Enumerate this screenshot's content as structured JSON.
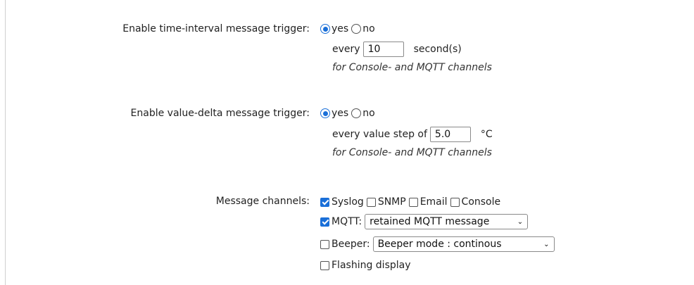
{
  "time_trigger": {
    "label": "Enable time-interval message trigger:",
    "yes": "yes",
    "no": "no",
    "selected": "yes",
    "every_label": "every",
    "value": "10",
    "unit": "second(s)",
    "note": "for Console- and MQTT channels"
  },
  "delta_trigger": {
    "label": "Enable value-delta message trigger:",
    "yes": "yes",
    "no": "no",
    "selected": "yes",
    "every_label": "every value step of",
    "value": "5.0",
    "unit": "°C",
    "note": "for Console- and MQTT channels"
  },
  "channels": {
    "label": "Message channels:",
    "syslog": {
      "label": "Syslog",
      "checked": true
    },
    "snmp": {
      "label": "SNMP",
      "checked": false
    },
    "email": {
      "label": "Email",
      "checked": false
    },
    "console": {
      "label": "Console",
      "checked": false
    },
    "mqtt": {
      "label": "MQTT:",
      "checked": true,
      "select_value": "retained MQTT message"
    },
    "beeper": {
      "label": "Beeper:",
      "checked": false,
      "select_value": "Beeper mode : continous"
    },
    "flashing": {
      "label": "Flashing display",
      "checked": false
    }
  },
  "colors": {
    "accent": "#1a6fd8"
  }
}
